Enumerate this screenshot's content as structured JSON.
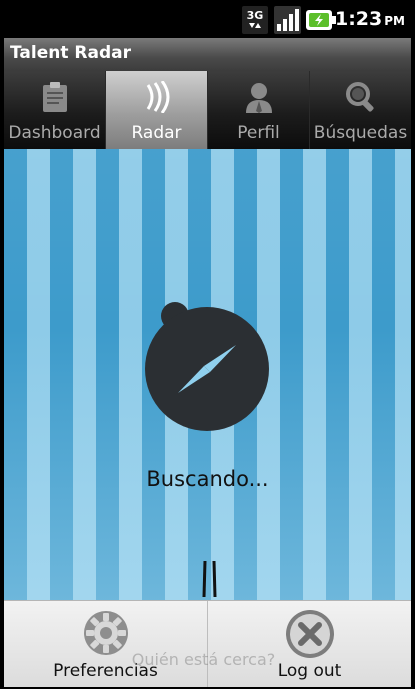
{
  "status_bar": {
    "network": "3G",
    "time": "1:23",
    "ampm": "PM"
  },
  "app": {
    "title": "Talent Radar"
  },
  "tabs": [
    {
      "label": "Dashboard",
      "icon": "clipboard-icon",
      "active": false
    },
    {
      "label": "Radar",
      "icon": "radar-waves-icon",
      "active": true
    },
    {
      "label": "Perfil",
      "icon": "person-icon",
      "active": false
    },
    {
      "label": "Búsquedas",
      "icon": "magnifier-icon",
      "active": false
    }
  ],
  "main": {
    "status": "Buscando...",
    "hint": "Quién está cerca?"
  },
  "menu": [
    {
      "label": "Preferencias",
      "icon": "gear-icon"
    },
    {
      "label": "Log out",
      "icon": "close-circle-icon"
    }
  ],
  "colors": {
    "stripe_dark": "#3d9bcb",
    "stripe_light": "#8ecbe8",
    "compass_body": "#2b2f33"
  }
}
